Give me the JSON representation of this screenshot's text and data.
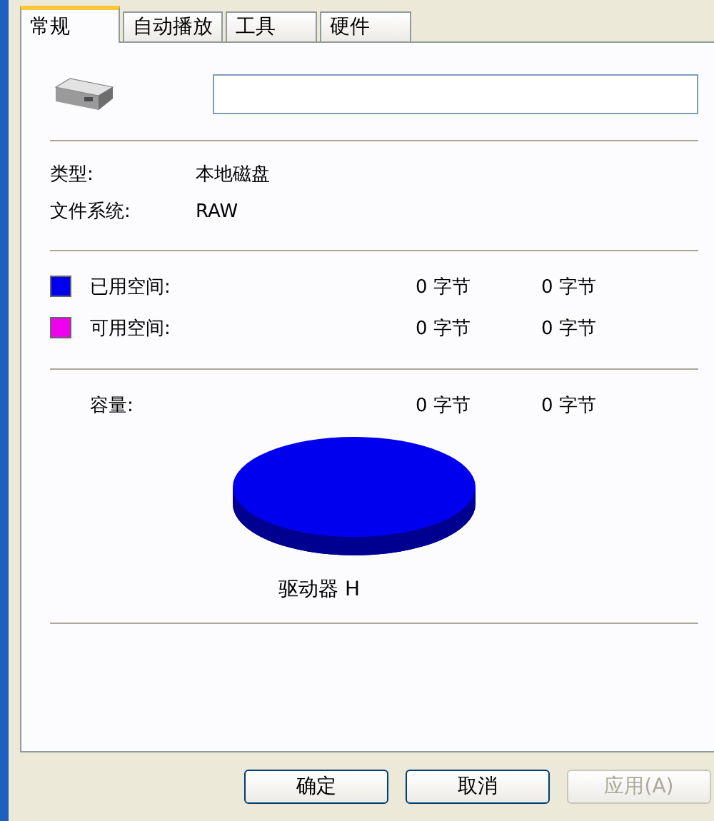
{
  "tabs": [
    {
      "label": "常规",
      "selected": true
    },
    {
      "label": "自动播放",
      "selected": false
    },
    {
      "label": "工具",
      "selected": false
    },
    {
      "label": "硬件",
      "selected": false
    }
  ],
  "info": [
    {
      "label": "类型:",
      "value": "本地磁盘"
    },
    {
      "label": "文件系统:",
      "value": "RAW"
    }
  ],
  "space": [
    {
      "label": "已用空间:",
      "color": "#0000ee",
      "bytes": "0 字节",
      "size": "0 字节"
    },
    {
      "label": "可用空间:",
      "color": "#ee00ee",
      "bytes": "0 字节",
      "size": "0 字节"
    }
  ],
  "capacity": {
    "label": "容量:",
    "bytes": "0 字节",
    "size": "0 字节"
  },
  "drive_label": "驱动器 H",
  "buttons": [
    {
      "label": "确定",
      "disabled": false
    },
    {
      "label": "取消",
      "disabled": false
    },
    {
      "label": "应用(A)",
      "disabled": true
    }
  ]
}
